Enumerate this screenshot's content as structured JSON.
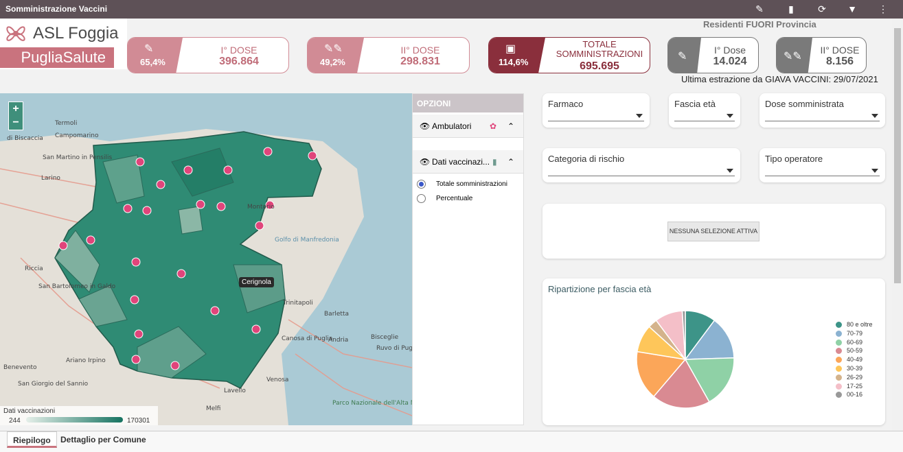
{
  "app": {
    "title": "Somministrazione Vaccini"
  },
  "branding": {
    "asl": "ASL Foggia",
    "puglia": "PugliaSalute"
  },
  "kpis": [
    {
      "pct": "65,4%",
      "label": "I° DOSE",
      "value": "396.864"
    },
    {
      "pct": "49,2%",
      "label": "II° DOSE",
      "value": "298.831"
    },
    {
      "pct": "114,6%",
      "label": "TOTALE SOMMINISTRAZIONI",
      "value": "695.695"
    },
    {
      "label": "I° Dose",
      "value": "14.024"
    },
    {
      "label": "II° DOSE",
      "value": "8.156"
    }
  ],
  "header_note": "Residenti FUORI Provincia",
  "extract": "Ultima estrazione da GIAVA VACCINI: 29/07/2021",
  "map": {
    "callout": "Cerignola",
    "legend": {
      "title": "Dati vaccinazioni",
      "min": "244",
      "max": "170301"
    },
    "labels": [
      "Termoli",
      "Campomarino",
      "San Martino in Pensilis",
      "Larino",
      "Riccia",
      "San Bartolomeo in Galdo",
      "Benevento",
      "San Giorgio del Sannio",
      "Andria",
      "Barletta",
      "Trinitapoli",
      "Bisceglie",
      "Canosa di Puglia",
      "Golfo di Manfredonia",
      "Ariano Irpino",
      "Lavello",
      "Parco Nazionale dell'Alta Murgia",
      "Ruvo di Puglia",
      "Melfi",
      "Venosa",
      "di Biscaccia",
      "Montorio"
    ]
  },
  "options": {
    "title": "OPZIONI",
    "ambulatori": "Ambulatori",
    "dati": "Dati vaccinazi...",
    "radio": [
      {
        "label": "Totale somministrazioni",
        "checked": true
      },
      {
        "label": "Percentuale",
        "checked": false
      }
    ]
  },
  "filters": [
    {
      "label": "Farmaco"
    },
    {
      "label": "Fascia età"
    },
    {
      "label": "Dose somministrata"
    },
    {
      "label": "Categoria di rischio"
    },
    {
      "label": "Tipo operatore"
    }
  ],
  "no_selection": "NESSUNA SELEZIONE ATTIVA",
  "chart_data": {
    "type": "pie",
    "title": "Ripartizione per fascia età",
    "categories": [
      "80 e oltre",
      "70-79",
      "60-69",
      "50-59",
      "40-49",
      "30-39",
      "26-29",
      "17-25",
      "00-16"
    ],
    "values": [
      10,
      14,
      17,
      19,
      16,
      9,
      3,
      9,
      1
    ],
    "colors": [
      "#3d9488",
      "#8bb2d1",
      "#8fd1a6",
      "#d98a92",
      "#fba659",
      "#fec65a",
      "#d4b38c",
      "#f4bfc8",
      "#999999"
    ],
    "legend_position": "right"
  },
  "tabs": [
    {
      "label": "Riepilogo",
      "active": true
    },
    {
      "label": "Dettaglio per Comune",
      "active": false
    }
  ]
}
